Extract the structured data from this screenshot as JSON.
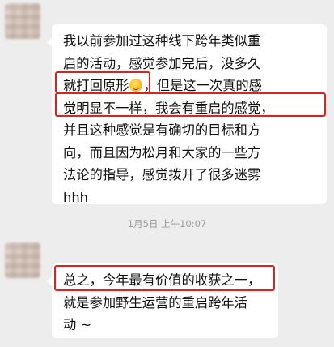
{
  "messages": [
    {
      "sender": "other",
      "lines": [
        "我以前参加过这种线下跨年类似重",
        "启的活动，感觉参加完后，没多久",
        "就打回原形",
        "，但是这一次真的感",
        "觉明显不一样，我会有重启的感觉，",
        "并且这种感觉是有确切的目标和方",
        "向，而且因为松月和大家的一些方",
        "法论的指导，感觉拨开了很多迷雾",
        "hhh"
      ],
      "emoji": "grinning-sweat-emoji"
    },
    {
      "sender": "other",
      "lines": [
        "总之，今年最有价值的收获之一，",
        "就是参加野生运营的重启跨年活",
        "动 ~"
      ]
    }
  ],
  "timestamp": "1月5日 上午10:07",
  "colors": {
    "background": "#ededed",
    "bubble": "#ffffff",
    "highlight": "#e1211b",
    "timestamp": "#9b9b9b"
  }
}
